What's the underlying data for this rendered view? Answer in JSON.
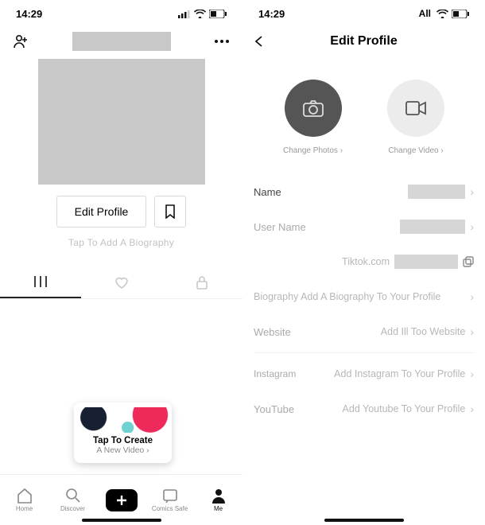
{
  "left": {
    "status": {
      "time": "14:29"
    },
    "editProfileBtn": "Edit Profile",
    "bio": "Tap To Add A Biography",
    "tooltip": {
      "l1": "Tap To Create",
      "l2": "A New Video ›"
    },
    "nav": {
      "home": "Home",
      "discover": "Discover",
      "inbox": "Comics Safe",
      "me": "Me"
    }
  },
  "right": {
    "status": {
      "time": "14:29",
      "carrier": "All"
    },
    "title": "Edit Profile",
    "changePhoto": "Change Photos ›",
    "changeVideo": "Change Video ›",
    "rows": {
      "name": "Name",
      "username": "User Name",
      "tiktok": "Tiktok.com",
      "bioK": "Biography",
      "bioV": "Add A Biography To Your Profile",
      "websiteK": "Website",
      "websiteV": "Add Ill Too Website",
      "instaK": "Instagram",
      "instaV": "Add Instagram To Your Profile",
      "ytK": "YouTube",
      "ytV": "Add Youtube To Your Profile"
    }
  }
}
